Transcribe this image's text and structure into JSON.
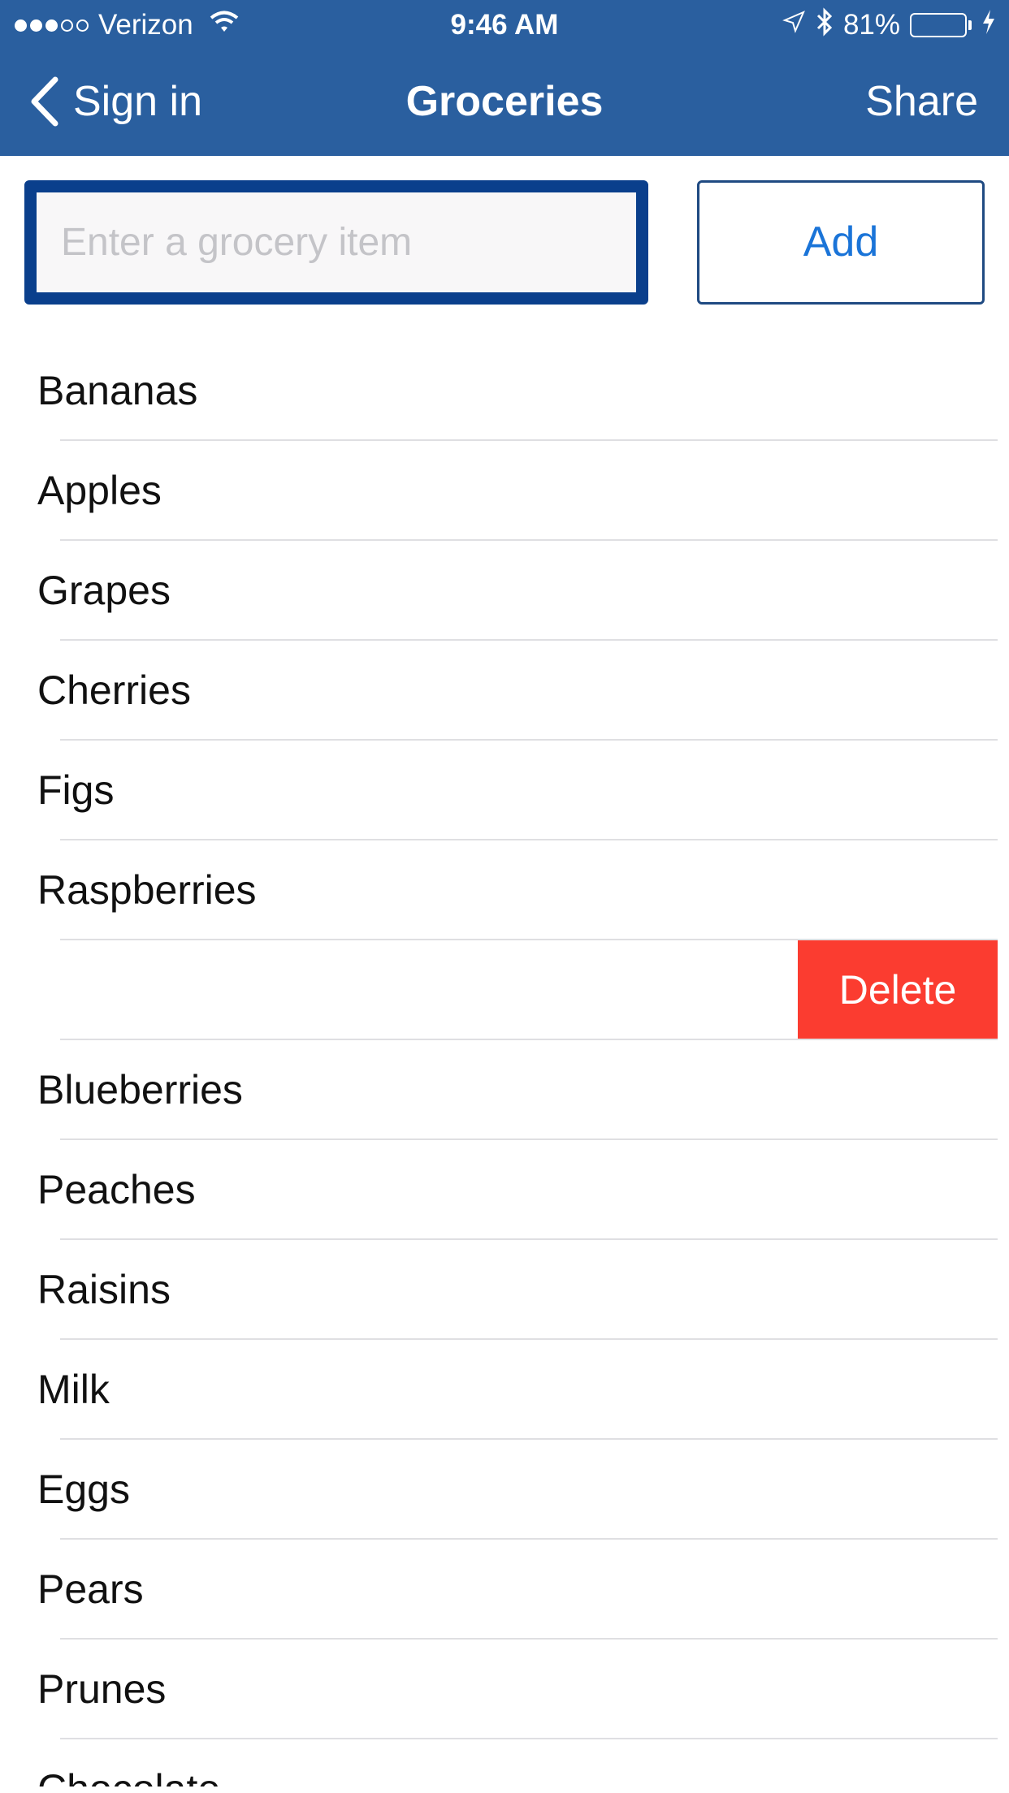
{
  "status_bar": {
    "carrier": "Verizon",
    "time": "9:46 AM",
    "battery_percent": "81%",
    "battery_level": 0.81,
    "signal_bars_filled": 3,
    "signal_bars_total": 5,
    "icons": [
      "signal-dots-icon",
      "wifi-icon",
      "location-arrow-icon",
      "bluetooth-icon",
      "battery-icon",
      "charging-bolt-icon"
    ]
  },
  "navbar": {
    "back_label": "Sign in",
    "title": "Groceries",
    "share_label": "Share"
  },
  "entry": {
    "placeholder": "Enter a grocery item",
    "value": "",
    "add_label": "Add"
  },
  "colors": {
    "nav_background": "#2a5f9f",
    "input_border": "#0a3f8c",
    "add_text": "#1a74d8",
    "delete_background": "#fb3c30",
    "battery_fill": "#4cd964"
  },
  "list": {
    "items": [
      {
        "label": "Bananas"
      },
      {
        "label": "Apples"
      },
      {
        "label": "Grapes"
      },
      {
        "label": "Cherries"
      },
      {
        "label": "Figs"
      },
      {
        "label": "Raspberries"
      },
      {
        "label": "",
        "swiped": true,
        "delete_label": "Delete"
      },
      {
        "label": "Blueberries"
      },
      {
        "label": "Peaches"
      },
      {
        "label": "Raisins"
      },
      {
        "label": "Milk"
      },
      {
        "label": "Eggs"
      },
      {
        "label": "Pears"
      },
      {
        "label": "Prunes"
      },
      {
        "label": "Chocolate"
      }
    ]
  }
}
